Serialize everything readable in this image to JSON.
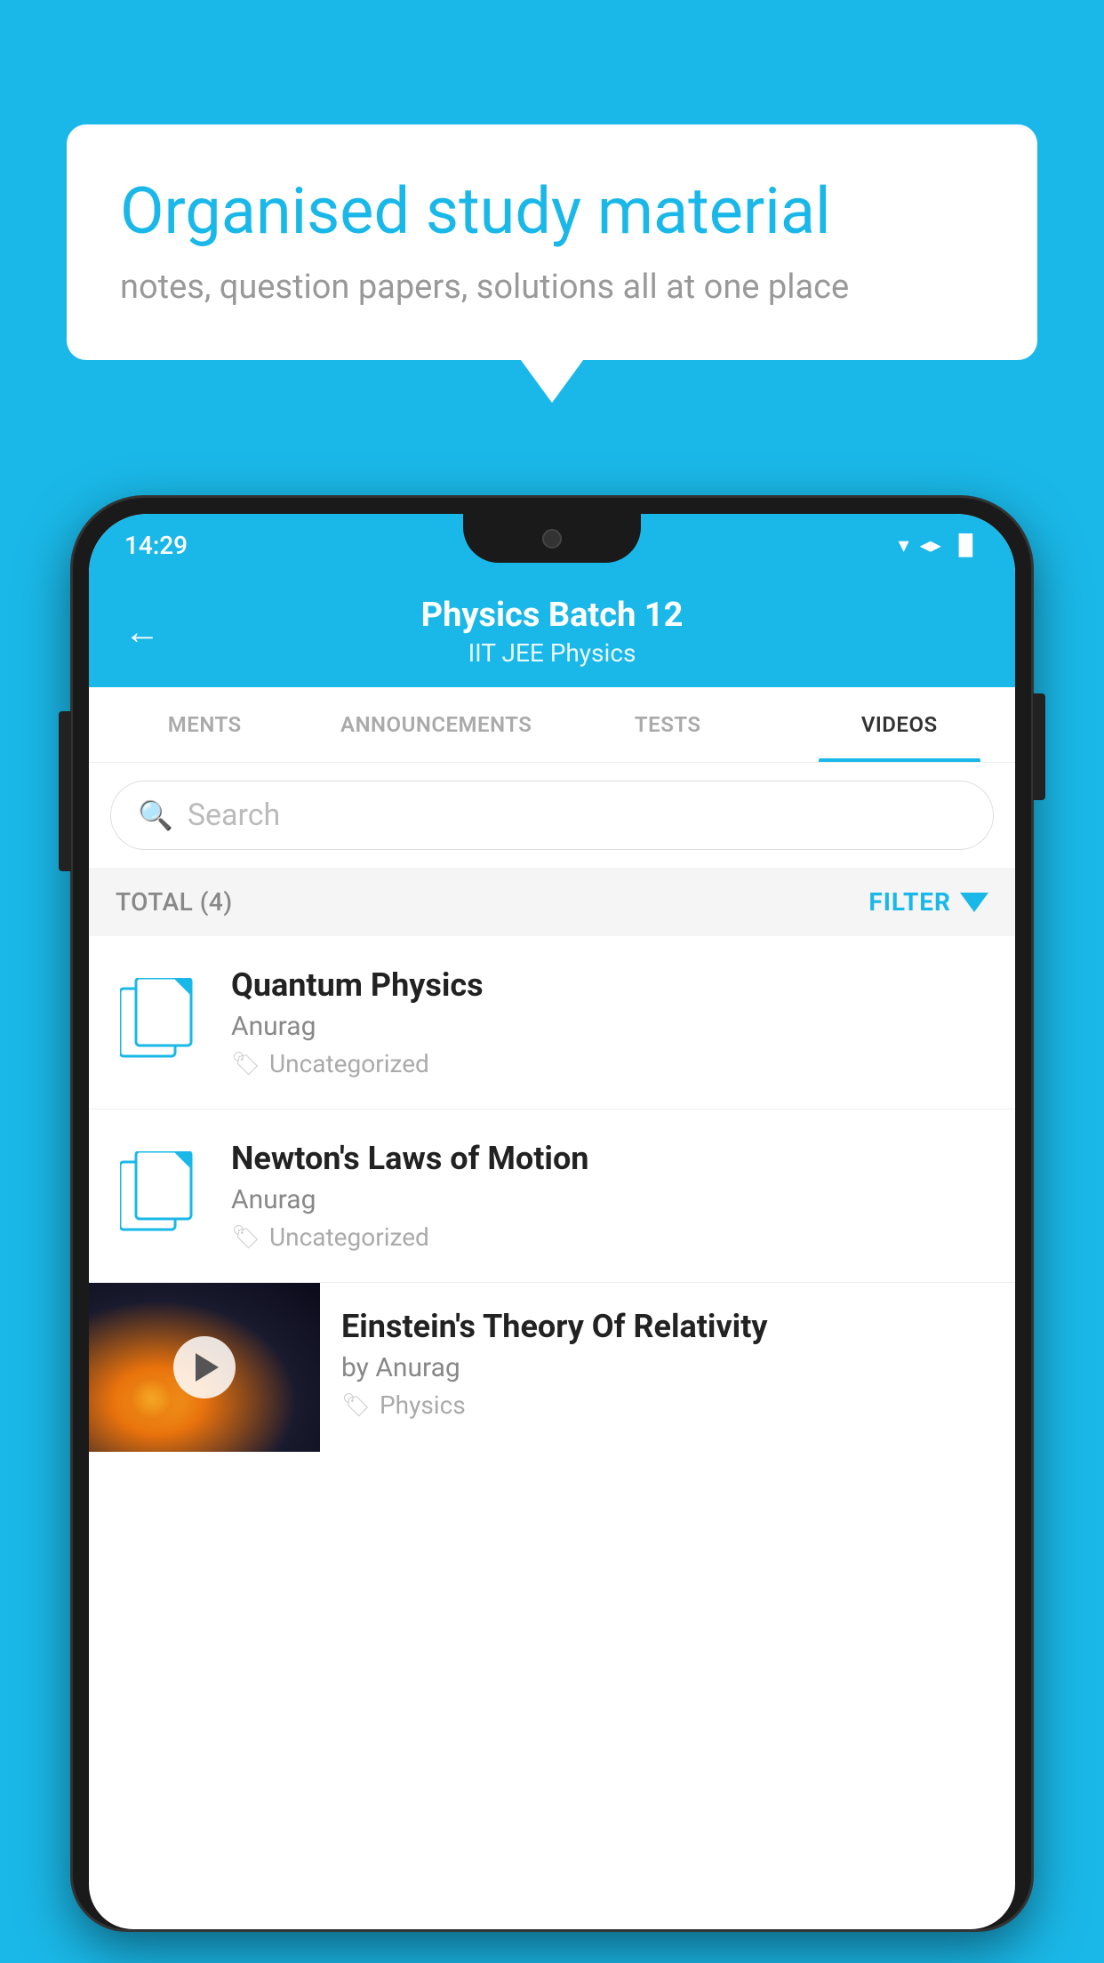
{
  "background_color": "#1ab8e8",
  "speech_bubble": {
    "title": "Organised study material",
    "subtitle": "notes, question papers, solutions all at one place"
  },
  "phone": {
    "status_bar": {
      "time": "14:29",
      "wifi": "▼",
      "signal": "▲",
      "battery": "▐"
    },
    "header": {
      "back_label": "←",
      "title": "Physics Batch 12",
      "subtitle_tags": "IIT JEE    Physics"
    },
    "tabs": [
      {
        "label": "MENTS",
        "active": false
      },
      {
        "label": "ANNOUNCEMENTS",
        "active": false
      },
      {
        "label": "TESTS",
        "active": false
      },
      {
        "label": "VIDEOS",
        "active": true
      }
    ],
    "search": {
      "placeholder": "Search"
    },
    "filter_bar": {
      "total_label": "TOTAL (4)",
      "filter_label": "FILTER"
    },
    "videos": [
      {
        "id": "1",
        "title": "Quantum Physics",
        "author": "Anurag",
        "tag": "Uncategorized",
        "has_thumb": false
      },
      {
        "id": "2",
        "title": "Newton's Laws of Motion",
        "author": "Anurag",
        "tag": "Uncategorized",
        "has_thumb": false
      },
      {
        "id": "3",
        "title": "Einstein's Theory Of Relativity",
        "author": "by Anurag",
        "tag": "Physics",
        "has_thumb": true
      }
    ]
  }
}
